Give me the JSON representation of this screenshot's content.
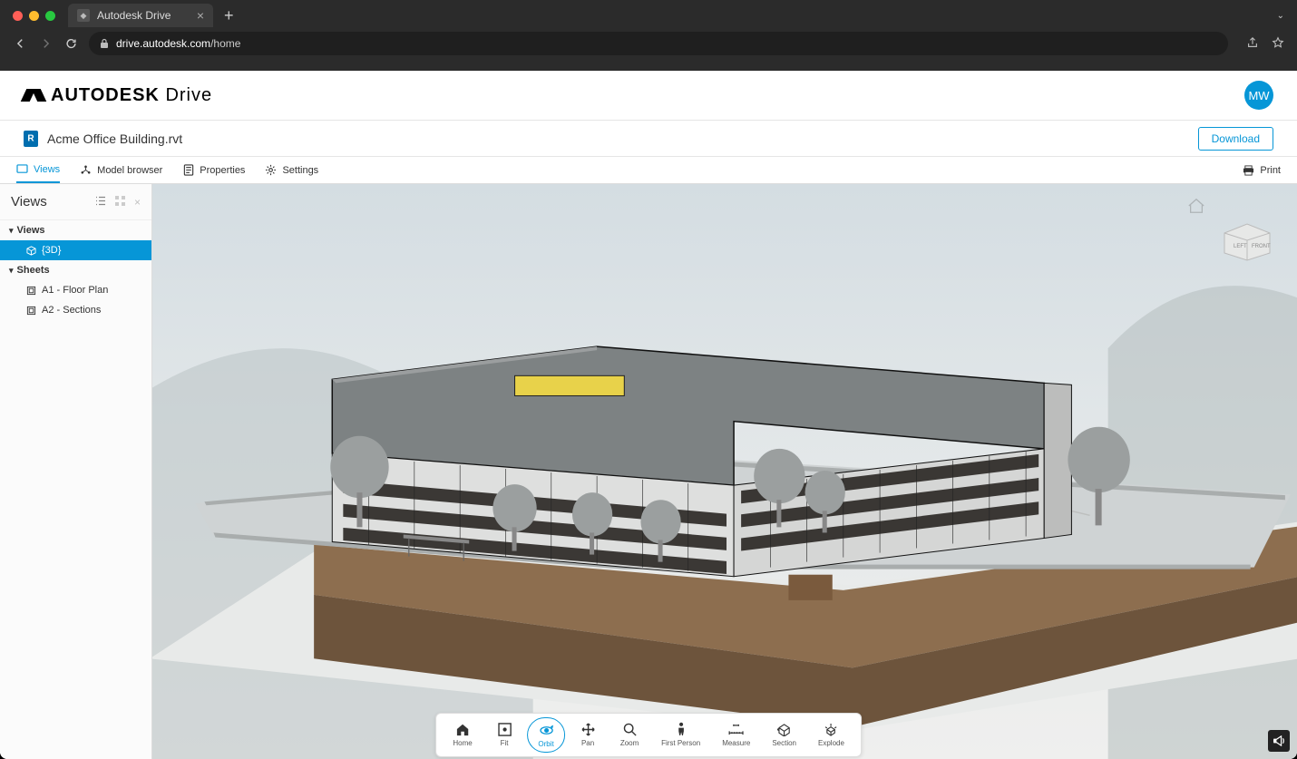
{
  "browser": {
    "tab_title": "Autodesk Drive",
    "url_display_host": "drive.autodesk.com",
    "url_display_path": "/home"
  },
  "header": {
    "brand_bold": "AUTODESK",
    "brand_light": "Drive",
    "avatar_initials": "MW"
  },
  "file_bar": {
    "file_name": "Acme Office Building.rvt",
    "download_label": "Download"
  },
  "toolbar": {
    "views": "Views",
    "model_browser": "Model browser",
    "properties": "Properties",
    "settings": "Settings",
    "print": "Print"
  },
  "sidebar": {
    "title": "Views",
    "group_views": "Views",
    "item_3d": "{3D}",
    "group_sheets": "Sheets",
    "item_a1": "A1 - Floor Plan",
    "item_a2": "A2 - Sections"
  },
  "viewcube": {
    "left": "LEFT",
    "front": "FRONT"
  },
  "bottom_toolbar": {
    "home": "Home",
    "fit": "Fit",
    "orbit": "Orbit",
    "pan": "Pan",
    "zoom": "Zoom",
    "first_person": "First Person",
    "measure": "Measure",
    "section": "Section",
    "explode": "Explode"
  }
}
